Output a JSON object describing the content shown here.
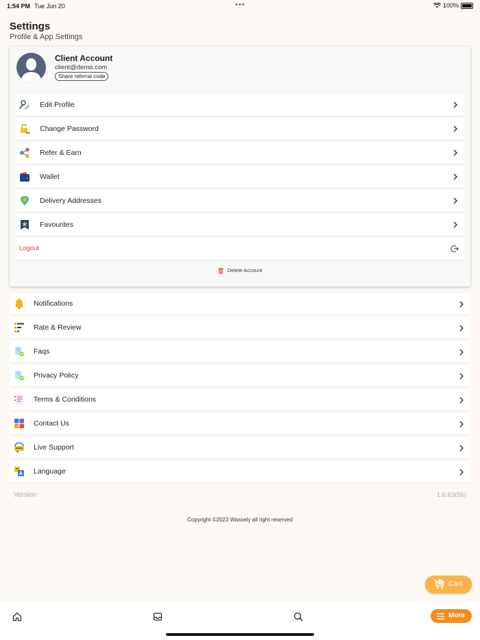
{
  "status_bar": {
    "time": "1:54 PM",
    "date": "Tue Jun 20",
    "battery": "100%"
  },
  "header": {
    "title": "Settings",
    "subtitle": "Profile & App Settings"
  },
  "account": {
    "name": "Client Account",
    "email": "client@demo.com",
    "referral_label": "Share referral code",
    "items": [
      {
        "label": "Edit Profile",
        "icon": "edit-profile-icon"
      },
      {
        "label": "Change Password",
        "icon": "password-lock-icon"
      },
      {
        "label": "Refer & Earn",
        "icon": "share-icon"
      },
      {
        "label": "Wallet",
        "icon": "wallet-icon"
      },
      {
        "label": "Delivery Addresses",
        "icon": "location-pin-icon"
      },
      {
        "label": "Favourites",
        "icon": "bookmark-star-icon"
      }
    ],
    "logout_label": "Logout",
    "delete_label": "Delete Account"
  },
  "menu": [
    {
      "label": "Notifications",
      "icon": "bell-icon"
    },
    {
      "label": "Rate & Review",
      "icon": "rating-list-icon"
    },
    {
      "label": "Faqs",
      "icon": "faq-document-icon"
    },
    {
      "label": "Privacy Policy",
      "icon": "privacy-document-icon"
    },
    {
      "label": "Terms & Conditions",
      "icon": "terms-document-icon"
    },
    {
      "label": "Contact Us",
      "icon": "contact-grid-icon"
    },
    {
      "label": "Live Support",
      "icon": "headset-icon"
    },
    {
      "label": "Language",
      "icon": "language-icon"
    }
  ],
  "version": {
    "label": "Version",
    "value": "1.6.63(55)"
  },
  "copyright": "Copyright ©2023 Wassely all right reserved",
  "cart": {
    "label": "Cart",
    "count": "0"
  },
  "bottom_nav": {
    "more_label": "More"
  },
  "colors": {
    "background": "#fcf9f4",
    "accent": "#f58a1f",
    "cart": "#fbb246",
    "logout": "#e23b3b"
  }
}
